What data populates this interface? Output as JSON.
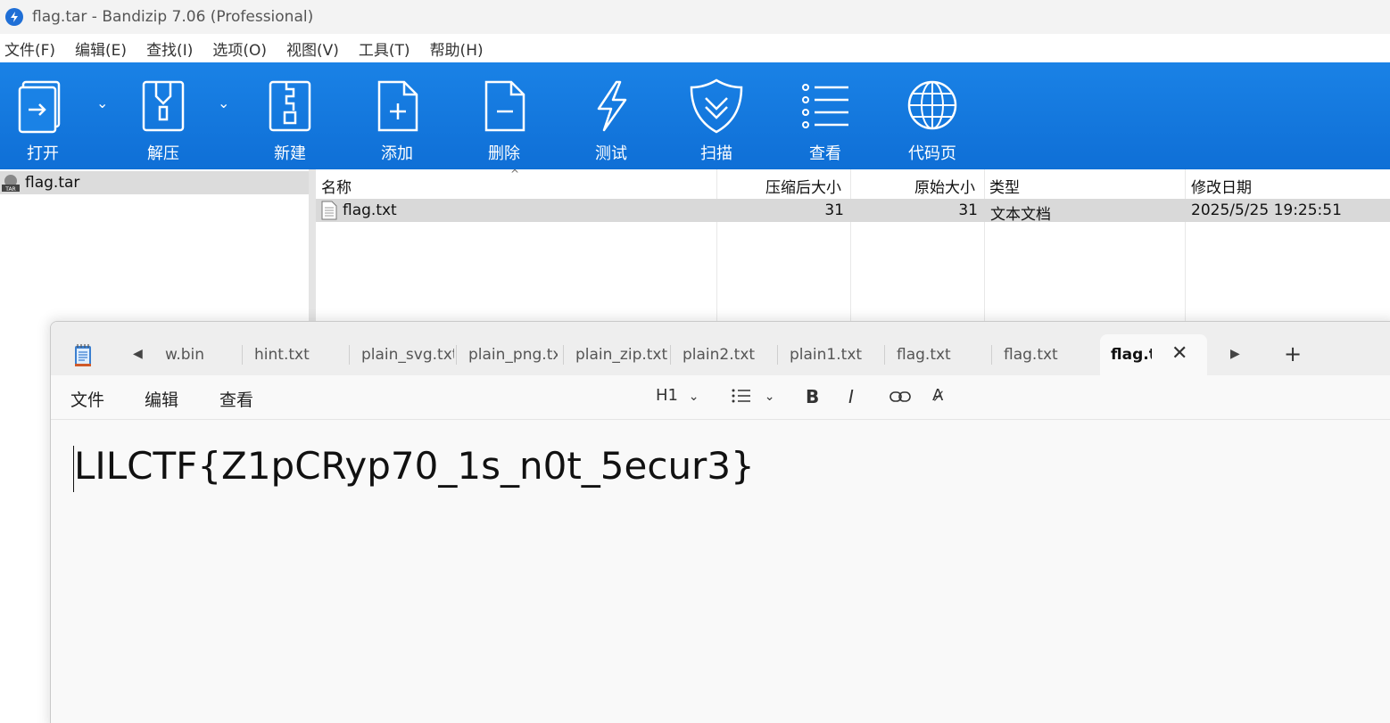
{
  "bandizip": {
    "title": "flag.tar - Bandizip 7.06 (Professional)",
    "menu": [
      "文件(F)",
      "编辑(E)",
      "查找(I)",
      "选项(O)",
      "视图(V)",
      "工具(T)",
      "帮助(H)"
    ],
    "toolbar": {
      "open": "打开",
      "extract": "解压",
      "new": "新建",
      "add": "添加",
      "delete": "删除",
      "test": "测试",
      "scan": "扫描",
      "view": "查看",
      "codepage": "代码页"
    },
    "tree": {
      "archive": "flag.tar"
    },
    "list": {
      "headers": {
        "name": "名称",
        "compressed": "压缩后大小",
        "original": "原始大小",
        "type": "类型",
        "modified": "修改日期"
      },
      "rows": [
        {
          "name": "flag.txt",
          "compressed": "31",
          "original": "31",
          "type": "文本文档",
          "modified": "2025/5/25 19:25:51"
        }
      ]
    },
    "colors": {
      "toolbar": "#1a82e6",
      "selection": "#d9d9d9"
    }
  },
  "notepad": {
    "tabs": [
      "w.bin",
      "hint.txt",
      "plain_svg.txt",
      "plain_png.txt",
      "plain_zip.txt",
      "plain2.txt",
      "plain1.txt",
      "flag.txt",
      "flag.txt"
    ],
    "active_tab": "flag.t:",
    "menu": {
      "file": "文件",
      "edit": "编辑",
      "view": "查看"
    },
    "format": {
      "heading": "H1"
    },
    "content": "LILCTF{Z1pCRyp70_1s_n0t_5ecur3}"
  }
}
